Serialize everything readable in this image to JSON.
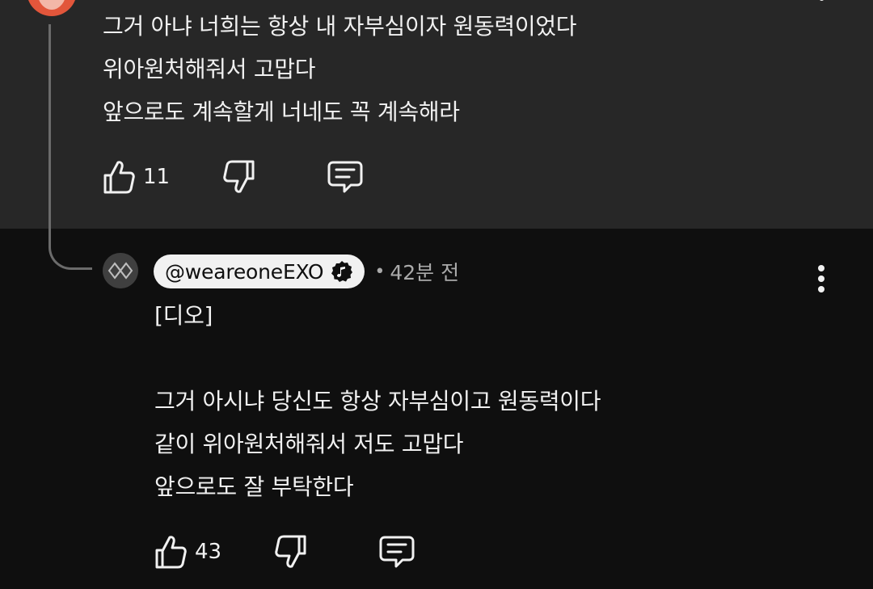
{
  "top_comment": {
    "lines": [
      "그거 아냐 너희는 항상 내 자부심이자 원동력이었다",
      "위아원처해줘서 고맙다",
      "앞으로도 계속할게 너네도 꼭 계속해라"
    ],
    "like_count": "11"
  },
  "reply": {
    "author": "@weareoneEXO",
    "separator": "•",
    "time": "42분 전",
    "lines": [
      "[디오]",
      "",
      "그거 아시냐 당신도 항상 자부심이고 원동력이다",
      "같이 위아원처해줘서 저도 고맙다",
      "앞으로도 잘 부탁한다"
    ],
    "like_count": "43"
  },
  "icons": {
    "like": "thumbs-up-icon",
    "dislike": "thumbs-down-icon",
    "reply": "comment-icon",
    "more": "more-vertical-icon",
    "verified": "music-note-badge-icon"
  },
  "colors": {
    "highlight_bg": "#272727",
    "page_bg": "#0f0f0f",
    "text": "#f1f1f1",
    "secondary_text": "#aaaaaa",
    "avatar_orange": "#e2563b",
    "author_pill_bg": "#f1f1f1"
  }
}
